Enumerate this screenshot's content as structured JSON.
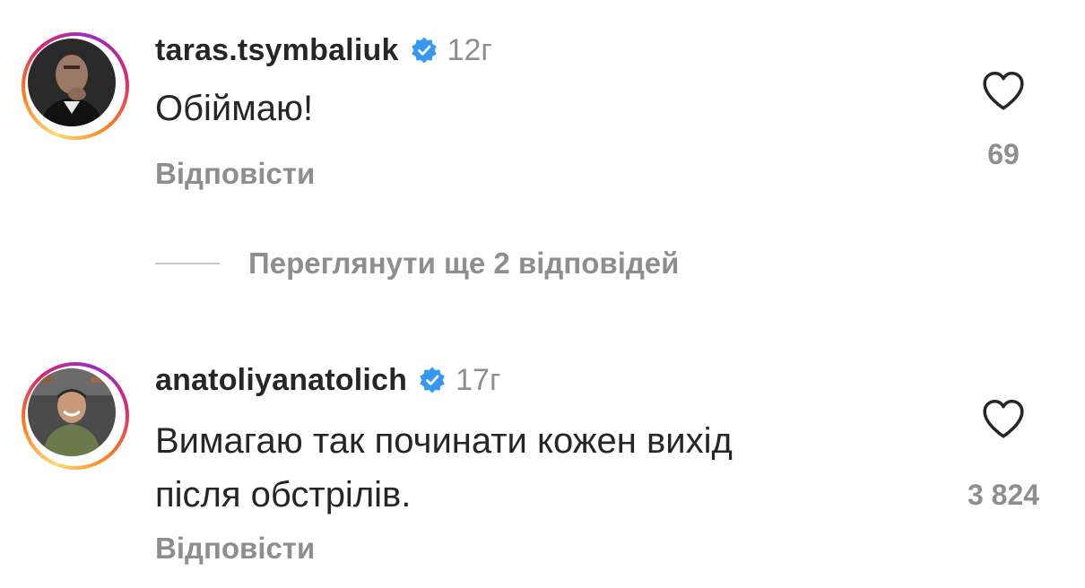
{
  "comments": [
    {
      "username": "taras.tsymbaliuk",
      "verified_icon": "verified-badge-icon",
      "timestamp": "12г",
      "text_lines": [
        "Обіймаю!"
      ],
      "reply_label": "Відповісти",
      "like_icon": "heart-outline-icon",
      "like_count": "69"
    },
    {
      "username": "anatoliyanatolich",
      "verified_icon": "verified-badge-icon",
      "timestamp": "17г",
      "text_lines": [
        "Вимагаю так починати кожен вихід",
        "після обстрілів."
      ],
      "reply_label": "Відповісти",
      "like_icon": "heart-outline-icon",
      "like_count": "3 824"
    }
  ],
  "view_replies": {
    "label": "Переглянути ще 2 відповідей"
  },
  "colors": {
    "text_primary": "#262626",
    "text_secondary": "#8e8e8e",
    "verified_blue": "#3897f0",
    "divider": "#c7c7c7"
  }
}
